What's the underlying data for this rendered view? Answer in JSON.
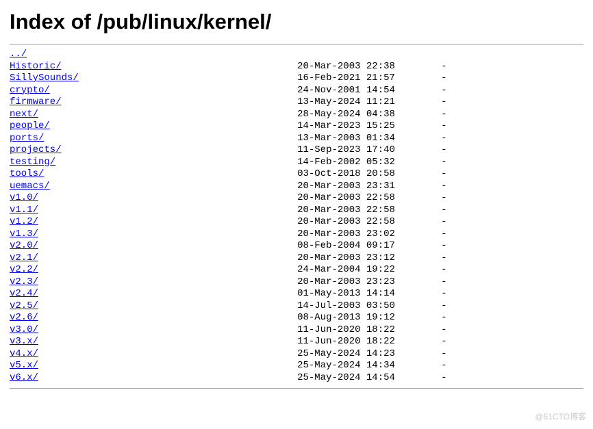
{
  "title": "Index of /pub/linux/kernel/",
  "parent": "../",
  "entries": [
    {
      "name": "Historic/",
      "date": "20-Mar-2003 22:38",
      "size": "-"
    },
    {
      "name": "SillySounds/",
      "date": "16-Feb-2021 21:57",
      "size": "-"
    },
    {
      "name": "crypto/",
      "date": "24-Nov-2001 14:54",
      "size": "-"
    },
    {
      "name": "firmware/",
      "date": "13-May-2024 11:21",
      "size": "-"
    },
    {
      "name": "next/",
      "date": "28-May-2024 04:38",
      "size": "-"
    },
    {
      "name": "people/",
      "date": "14-Mar-2023 15:25",
      "size": "-"
    },
    {
      "name": "ports/",
      "date": "13-Mar-2003 01:34",
      "size": "-"
    },
    {
      "name": "projects/",
      "date": "11-Sep-2023 17:40",
      "size": "-"
    },
    {
      "name": "testing/",
      "date": "14-Feb-2002 05:32",
      "size": "-"
    },
    {
      "name": "tools/",
      "date": "03-Oct-2018 20:58",
      "size": "-"
    },
    {
      "name": "uemacs/",
      "date": "20-Mar-2003 23:31",
      "size": "-"
    },
    {
      "name": "v1.0/",
      "date": "20-Mar-2003 22:58",
      "size": "-"
    },
    {
      "name": "v1.1/",
      "date": "20-Mar-2003 22:58",
      "size": "-"
    },
    {
      "name": "v1.2/",
      "date": "20-Mar-2003 22:58",
      "size": "-"
    },
    {
      "name": "v1.3/",
      "date": "20-Mar-2003 23:02",
      "size": "-"
    },
    {
      "name": "v2.0/",
      "date": "08-Feb-2004 09:17",
      "size": "-"
    },
    {
      "name": "v2.1/",
      "date": "20-Mar-2003 23:12",
      "size": "-"
    },
    {
      "name": "v2.2/",
      "date": "24-Mar-2004 19:22",
      "size": "-"
    },
    {
      "name": "v2.3/",
      "date": "20-Mar-2003 23:23",
      "size": "-"
    },
    {
      "name": "v2.4/",
      "date": "01-May-2013 14:14",
      "size": "-"
    },
    {
      "name": "v2.5/",
      "date": "14-Jul-2003 03:50",
      "size": "-"
    },
    {
      "name": "v2.6/",
      "date": "08-Aug-2013 19:12",
      "size": "-"
    },
    {
      "name": "v3.0/",
      "date": "11-Jun-2020 18:22",
      "size": "-"
    },
    {
      "name": "v3.x/",
      "date": "11-Jun-2020 18:22",
      "size": "-"
    },
    {
      "name": "v4.x/",
      "date": "25-May-2024 14:23",
      "size": "-"
    },
    {
      "name": "v5.x/",
      "date": "25-May-2024 14:34",
      "size": "-"
    },
    {
      "name": "v6.x/",
      "date": "25-May-2024 14:54",
      "size": "-"
    }
  ],
  "watermark": "@51CTO博客",
  "layout": {
    "nameCol": 50,
    "dateCol": 17,
    "sizeCol": 5
  }
}
